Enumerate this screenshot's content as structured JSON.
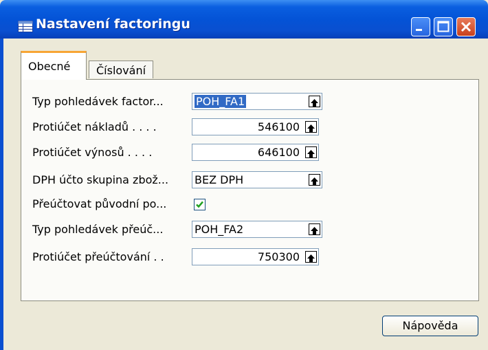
{
  "window": {
    "title": "Nastavení factoringu"
  },
  "tabs": [
    {
      "label": "Obecné",
      "active": true
    },
    {
      "label": "Číslování",
      "active": false
    }
  ],
  "form": {
    "rows": [
      {
        "label": "Typ pohledávek factor...",
        "value": "POH_FA1",
        "kind": "text",
        "selected": true
      },
      {
        "label": "Protiúčet nákladů . . . .",
        "value": "546100",
        "kind": "num"
      },
      {
        "label": "Protiúčet výnosů . . . .",
        "value": "646100",
        "kind": "num"
      },
      {
        "label": "DPH účto skupina zbož...",
        "value": "BEZ DPH",
        "kind": "text"
      },
      {
        "label": "Přeúčtovat původní po...",
        "checked": true,
        "kind": "check"
      },
      {
        "label": "Typ pohledávek přeúč...",
        "value": "POH_FA2",
        "kind": "text"
      },
      {
        "label": "Protiúčet přeúčtování . .",
        "value": "750300",
        "kind": "num"
      }
    ]
  },
  "buttons": {
    "help": "Nápověda"
  },
  "icons": {
    "title": "table-icon",
    "lookup": "lookup-arrow-icon",
    "minimize": "minimize-icon",
    "maximize": "maximize-icon",
    "close": "close-icon"
  },
  "colors": {
    "titlebar": "#0453d6",
    "selection": "#316ac5",
    "check": "#21a121",
    "tab_highlight": "#f7a534"
  }
}
